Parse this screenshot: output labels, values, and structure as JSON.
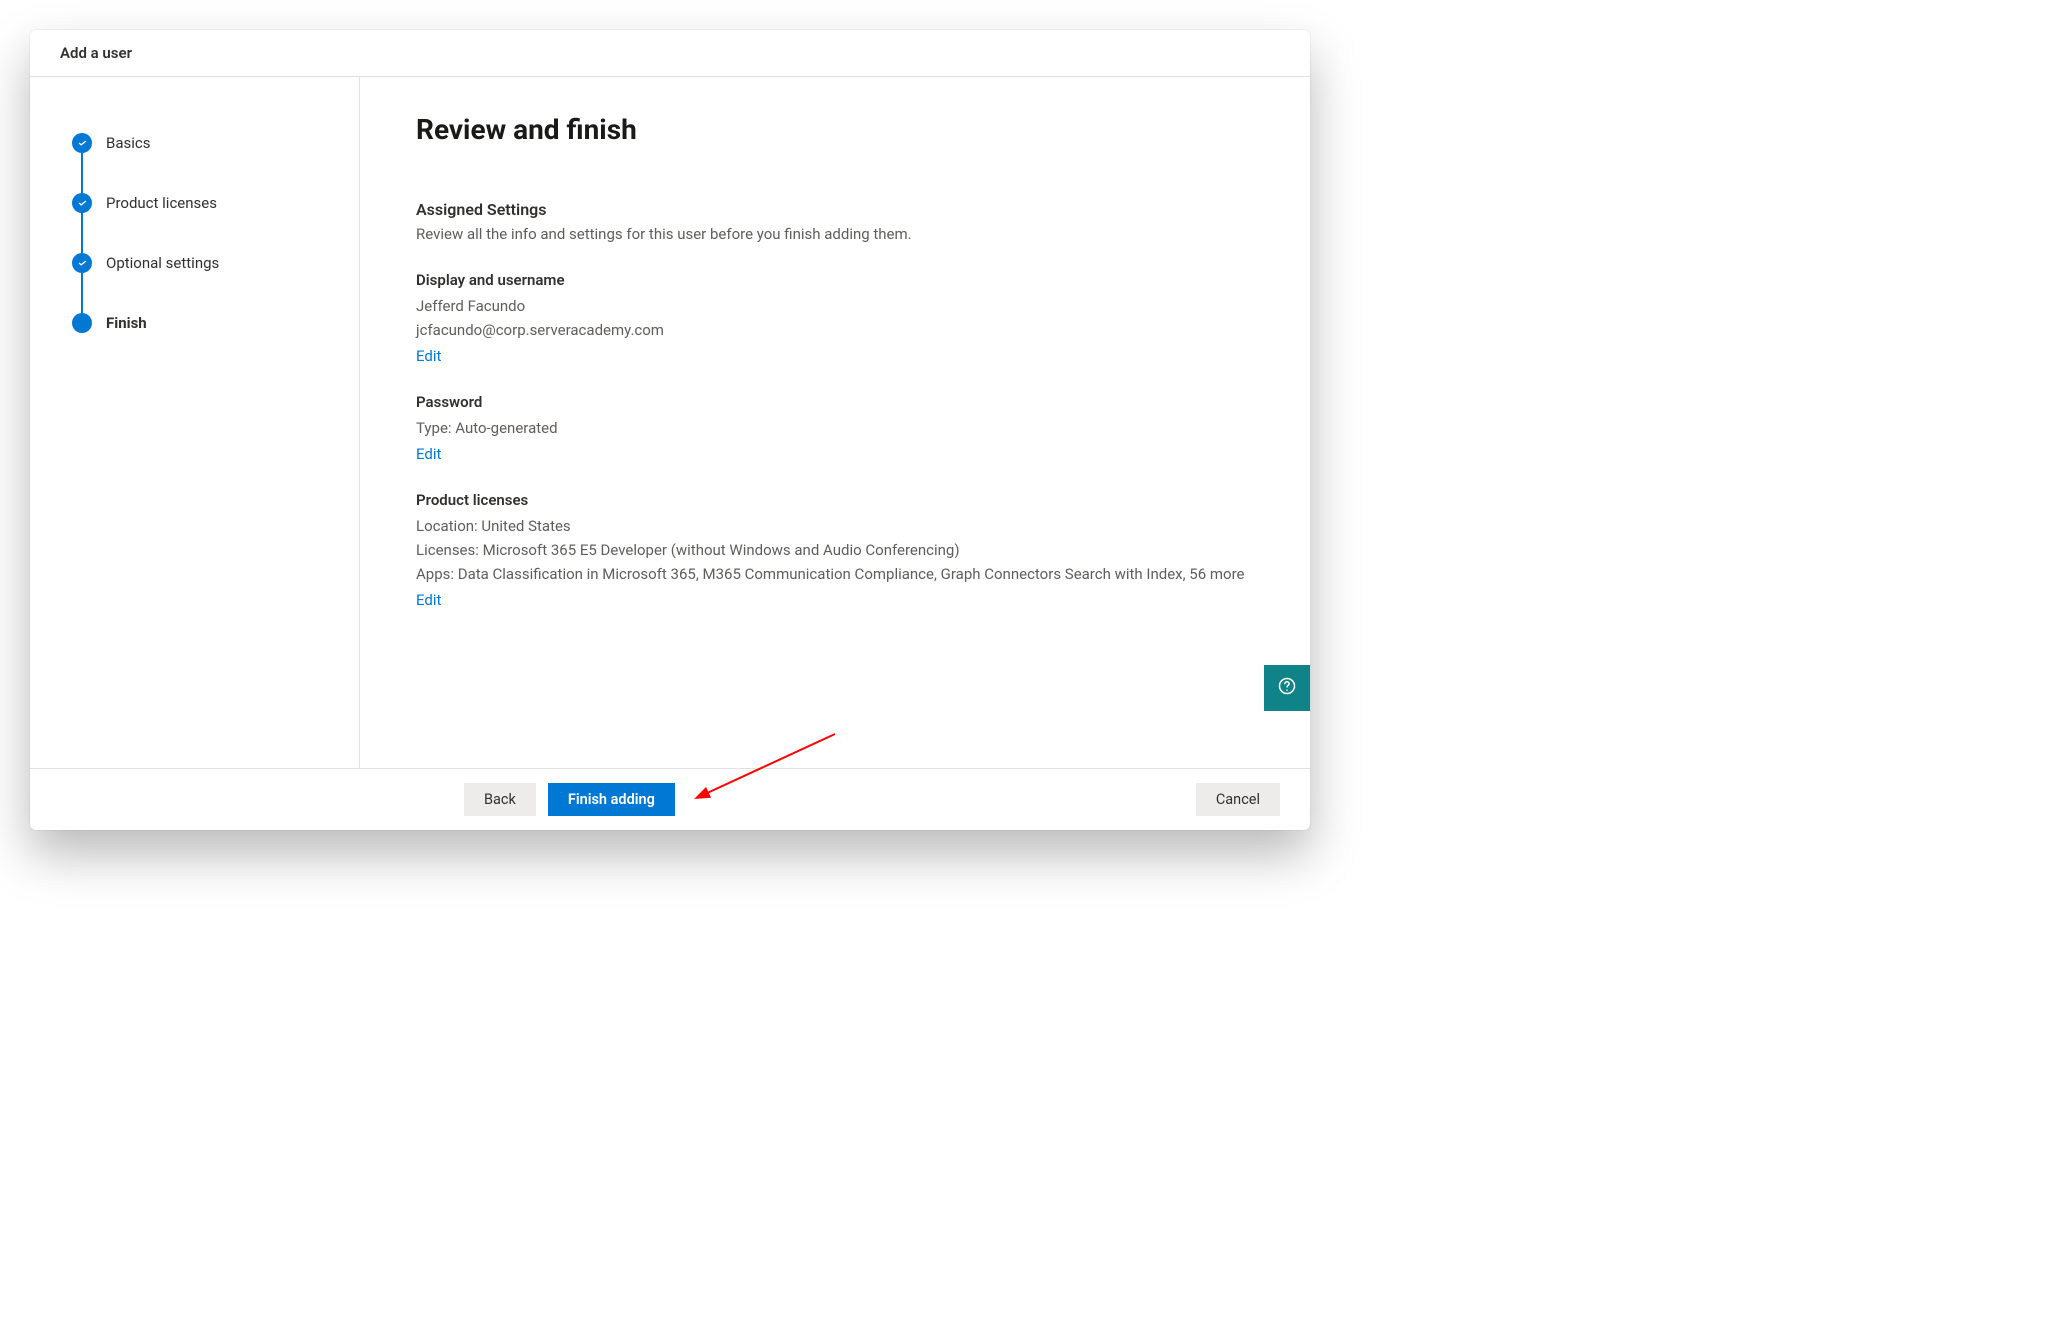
{
  "header": {
    "title": "Add a user"
  },
  "stepper": {
    "steps": [
      {
        "label": "Basics",
        "state": "done"
      },
      {
        "label": "Product licenses",
        "state": "done"
      },
      {
        "label": "Optional settings",
        "state": "done"
      },
      {
        "label": "Finish",
        "state": "current"
      }
    ]
  },
  "main": {
    "title": "Review and finish",
    "assigned": {
      "heading": "Assigned Settings",
      "description": "Review all the info and settings for this user before you finish adding them."
    },
    "display": {
      "heading": "Display and username",
      "name": "Jefferd Facundo",
      "email": "jcfacundo@corp.serveracademy.com",
      "edit": "Edit"
    },
    "password": {
      "heading": "Password",
      "type_line": "Type: Auto-generated",
      "edit": "Edit"
    },
    "licenses": {
      "heading": "Product licenses",
      "location": "Location: United States",
      "licenses_line": "Licenses: Microsoft 365 E5 Developer (without Windows and Audio Conferencing)",
      "apps_line": "Apps: Data Classification in Microsoft 365, M365 Communication Compliance, Graph Connectors Search with Index, 56 more",
      "edit": "Edit"
    }
  },
  "footer": {
    "back": "Back",
    "finish": "Finish adding",
    "cancel": "Cancel"
  }
}
